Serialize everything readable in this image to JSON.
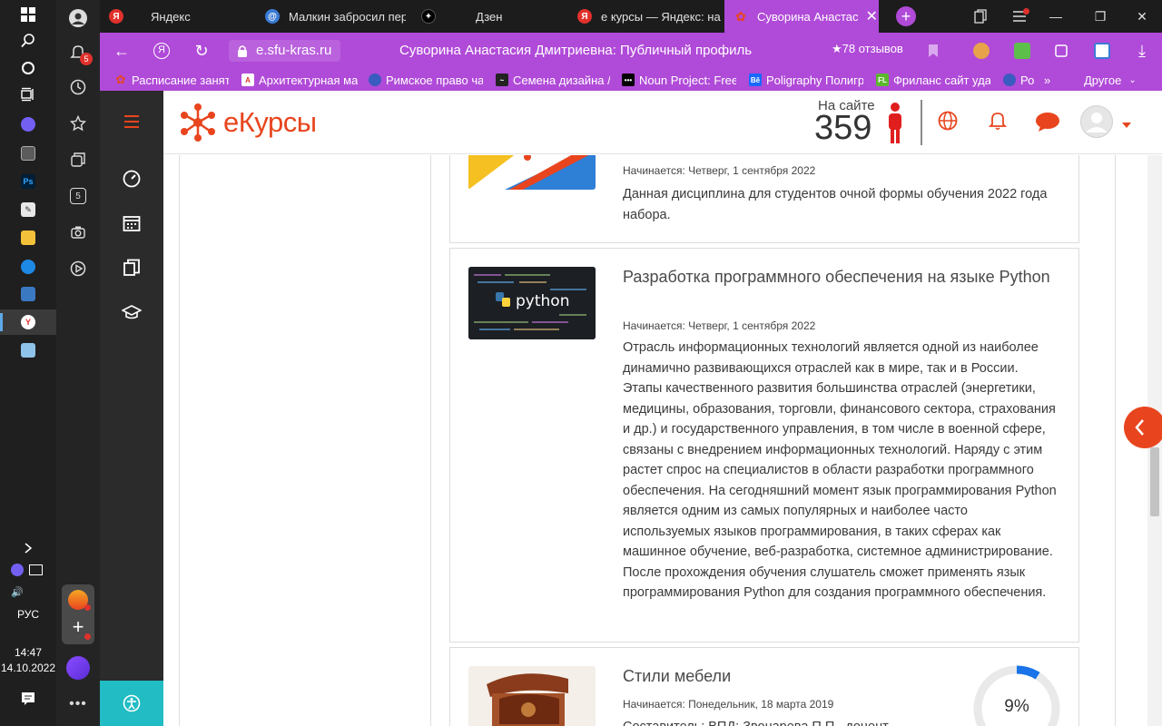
{
  "taskbar": {
    "icons": [
      "windows-start-icon",
      "search-icon",
      "cortana-icon",
      "task-view-icon",
      "viber-icon",
      "calculator-icon",
      "photoshop-icon",
      "drawing-app-icon",
      "file-explorer-icon",
      "feather-app-icon",
      "remote-desktop-icon",
      "yandex-browser-icon",
      "notepad-icon"
    ],
    "photoshop_label": "Ps",
    "language": "РУС",
    "time": "14:47",
    "date": "14.10.2022"
  },
  "yandex_panel": {
    "notifications_count": "5",
    "counter_label": "5"
  },
  "tabs": [
    {
      "label": "Яндекс",
      "favicon": "Я",
      "color": "#e0312c"
    },
    {
      "label": "Малкин забросил пер",
      "favicon": "@",
      "color": "#3a7bd5"
    },
    {
      "label": "Дзен",
      "favicon": "✦",
      "color": "#000000"
    },
    {
      "label": "е курсы — Яндекс: на",
      "favicon": "Я",
      "color": "#e0312c"
    },
    {
      "label": "Суворина Анастас",
      "favicon": "✿",
      "color": "#e8451e",
      "active": true
    }
  ],
  "addressbar": {
    "url": "e.sfu-kras.ru",
    "page_title": "Суворина Анастасия Дмитриевна: Публичный профиль",
    "reviews": "★78 отзывов"
  },
  "bookmarks": [
    "Расписание заняти",
    "Архитектурная ма",
    "Римское право ча",
    "Семена дизайна /",
    "Noun Project: Free",
    "Poligraphy Полигр",
    "Фриланс сайт уда",
    "Ро"
  ],
  "bookmarks_more": "»",
  "bookmarks_other": "Другое",
  "site": {
    "logo": "еКурсы",
    "online_label": "На сайте",
    "online_count": "359"
  },
  "courses": [
    {
      "title": "",
      "date": "Начинается: Четверг, 1 сентября 2022",
      "description": "Данная дисциплина для студентов очной формы обучения 2022 года набора."
    },
    {
      "title": "Разработка программного обеспечения на языке Python",
      "date": "Начинается: Четверг, 1 сентября 2022",
      "description": "Отрасль информационных технологий является одной из наиболее динамично развивающихся отраслей как в мире, так и в России. Этапы качественного развития большинства отраслей (энергетики, медицины, образования, торговли, финансового сектора, страхования и др.) и государственного управления, в том числе в военной сфере, связаны с внедрением информационных технологий. Наряду с этим растет спрос на специалистов в области разработки программного обеспечения. На сегодняшний момент язык программирования Python является одним из самых популярных и наиболее часто используемых языков программирования, в таких сферах как машинное обучение, веб-разработка, системное администрирование. После прохождения обучения слушатель сможет применять язык программирования Python для создания программного обеспечения.",
      "thumb_text": "python"
    },
    {
      "title": "Стили мебели",
      "date": "Начинается: Понедельник, 18 марта 2019",
      "description": "Составитель: ВПД: Звонарева П.П., доцент",
      "progress": "9%",
      "progress_value": 9
    }
  ],
  "colors": {
    "accent": "#e8451e",
    "browser": "#b04ad8",
    "progress": "#1a73e8"
  }
}
